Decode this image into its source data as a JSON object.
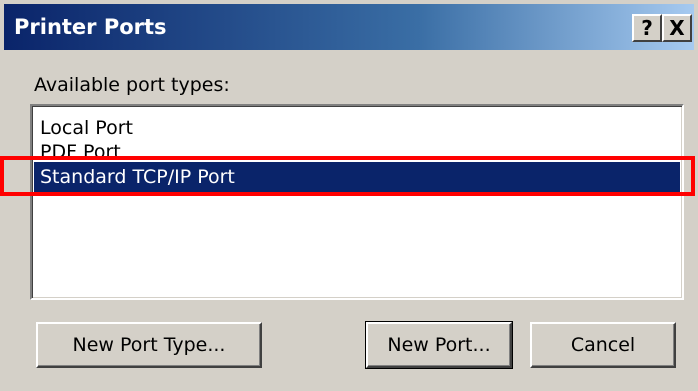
{
  "window": {
    "title": "Printer Ports",
    "help_button": "?",
    "close_button": "X"
  },
  "port_types": {
    "label": "Available port types:",
    "items": [
      "Local Port",
      "PDF Port",
      "Standard TCP/IP Port"
    ],
    "selected": "Standard TCP/IP Port"
  },
  "buttons": {
    "new_port_type": "New Port Type...",
    "new_port": "New Port...",
    "cancel": "Cancel"
  },
  "colors": {
    "selection": "#0a246a",
    "highlight_annotation": "#ff0000",
    "dialog_face": "#d4d0c8"
  }
}
